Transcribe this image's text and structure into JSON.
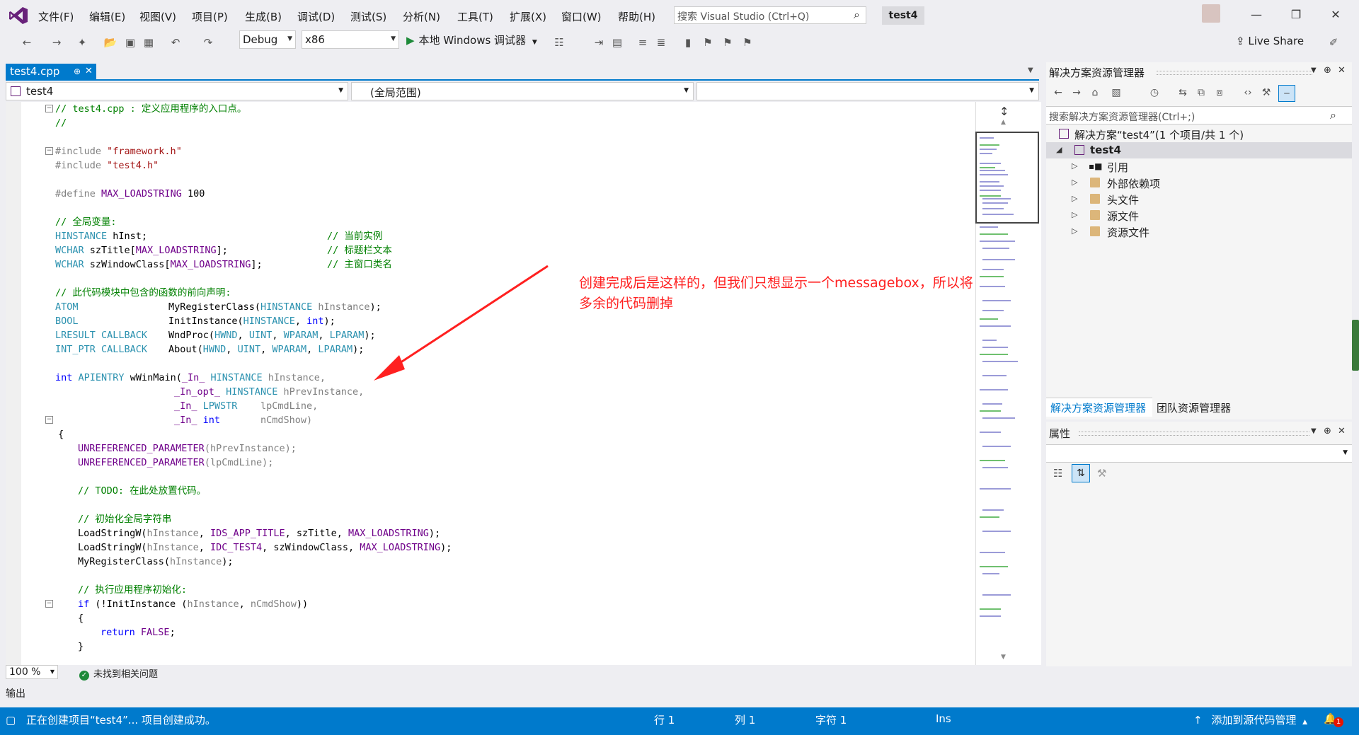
{
  "app": {
    "title_badge": "test4",
    "search_placeholder": "搜索 Visual Studio (Ctrl+Q)"
  },
  "menu": [
    "文件(F)",
    "编辑(E)",
    "视图(V)",
    "项目(P)",
    "生成(B)",
    "调试(D)",
    "测试(S)",
    "分析(N)",
    "工具(T)",
    "扩展(X)",
    "窗口(W)",
    "帮助(H)"
  ],
  "toolbar": {
    "config": "Debug",
    "platform": "x86",
    "run_label": "本地 Windows 调试器",
    "live_share": "Live Share"
  },
  "editor": {
    "tab_label": "test4.cpp",
    "nav_project": "test4",
    "nav_scope": "(全局范围)",
    "nav_member": "",
    "zoom": "100 %",
    "issues": "未找到相关问题"
  },
  "code": {
    "l1": "// test4.cpp : 定义应用程序的入口点。",
    "l2": "//",
    "l3a": "#include ",
    "l3b": "\"framework.h\"",
    "l4a": "#include ",
    "l4b": "\"test4.h\"",
    "l5a": "#define ",
    "l5b": "MAX_LOADSTRING",
    "l5c": " 100",
    "l6": "// 全局变量:",
    "l7a": "HINSTANCE",
    "l7b": " hInst;",
    "l7c": "// 当前实例",
    "l8a": "WCHAR",
    "l8b": " szTitle[",
    "l8m": "MAX_LOADSTRING",
    "l8e": "];",
    "l8c": "// 标题栏文本",
    "l9a": "WCHAR",
    "l9b": " szWindowClass[",
    "l9m": "MAX_LOADSTRING",
    "l9e": "];",
    "l9c": "// 主窗口类名",
    "l10": "// 此代码模块中包含的函数的前向声明:",
    "l11a": "ATOM",
    "l11b": "MyRegisterClass(",
    "l11t": "HINSTANCE",
    "l11p": " hInstance",
    "l11e": ");",
    "l12a": "BOOL",
    "l12b": "InitInstance(",
    "l12t": "HINSTANCE",
    "l12s": ", ",
    "l12k": "int",
    "l12e": ");",
    "l13a": "LRESULT CALLBACK",
    "l13b": "WndProc(",
    "l13t1": "HWND",
    "l13s1": ", ",
    "l13t2": "UINT",
    "l13s2": ", ",
    "l13t3": "WPARAM",
    "l13s3": ", ",
    "l13t4": "LPARAM",
    "l13e": ");",
    "l14a": "INT_PTR CALLBACK",
    "l14b": "About(",
    "l14t1": "HWND",
    "l14s1": ", ",
    "l14t2": "UINT",
    "l14s2": ", ",
    "l14t3": "WPARAM",
    "l14s3": ", ",
    "l14t4": "LPARAM",
    "l14e": ");",
    "l15a": "int",
    "l15b": " ",
    "l15t": "APIENTRY",
    "l15c": " wWinMain(",
    "l15m": "_In_",
    "l15s": " ",
    "l15h": "HINSTANCE",
    "l15p": " hInstance,",
    "l16m": "_In_opt_",
    "l16s": " ",
    "l16h": "HINSTANCE",
    "l16p": " hPrevInstance,",
    "l17m": "_In_",
    "l17s": " ",
    "l17h": "LPWSTR",
    "l17p": "    lpCmdLine,",
    "l18m": "_In_",
    "l18s": " ",
    "l18h": "int",
    "l18p": "       nCmdShow)",
    "l19": "{",
    "l20m": "UNREFERENCED_PARAMETER",
    "l20p": "(hPrevInstance);",
    "l21m": "UNREFERENCED_PARAMETER",
    "l21p": "(lpCmdLine);",
    "l22": "// TODO: 在此处放置代码。",
    "l23": "// 初始化全局字符串",
    "l24a": "LoadStringW(",
    "l24p": "hInstance",
    "l24s": ", ",
    "l24m": "IDS_APP_TITLE",
    "l24b": ", szTitle, ",
    "l24n": "MAX_LOADSTRING",
    "l24e": ");",
    "l25a": "LoadStringW(",
    "l25p": "hInstance",
    "l25s": ", ",
    "l25m": "IDC_TEST4",
    "l25b": ", szWindowClass, ",
    "l25n": "MAX_LOADSTRING",
    "l25e": ");",
    "l26a": "MyRegisterClass(",
    "l26p": "hInstance",
    "l26e": ");",
    "l27": "// 执行应用程序初始化:",
    "l28k": "if",
    "l28a": " (!InitInstance (",
    "l28p": "hInstance",
    "l28s": ", ",
    "l28q": "nCmdShow",
    "l28e": "))",
    "l29": "{",
    "l30k": "return",
    "l30s": " ",
    "l30m": "FALSE",
    "l30e": ";",
    "l31": "}"
  },
  "annotation": "创建完成后是这样的，但我们只想显示一个messagebox，所以将多余的代码删掉",
  "solution_explorer": {
    "title": "解决方案资源管理器",
    "search_placeholder": "搜索解决方案资源管理器(Ctrl+;)",
    "solution": "解决方案“test4”(1 个项目/共 1 个)",
    "project": "test4",
    "items": [
      "引用",
      "外部依赖项",
      "头文件",
      "源文件",
      "资源文件"
    ],
    "tabs": [
      "解决方案资源管理器",
      "团队资源管理器"
    ]
  },
  "properties": {
    "title": "属性"
  },
  "output": {
    "label": "输出"
  },
  "status": {
    "message": "正在创建项目“test4”... 项目创建成功。",
    "line": "行 1",
    "col": "列 1",
    "char": "字符 1",
    "ins": "Ins",
    "source_control": "添加到源代码管理",
    "notif_count": "1"
  },
  "colors": {
    "accent": "#007acc",
    "annotation": "#ff2020",
    "keyword": "#0000ff",
    "type": "#2b91af",
    "comment": "#008000",
    "macro": "#6f008a",
    "string": "#a31515"
  }
}
